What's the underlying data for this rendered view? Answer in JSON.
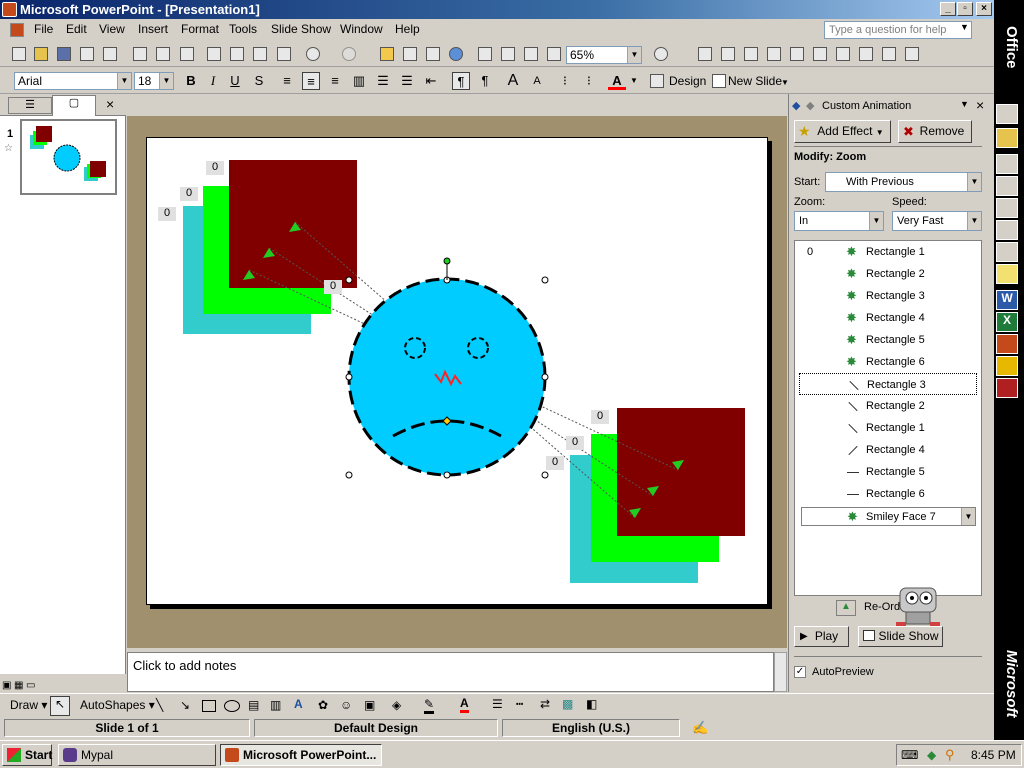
{
  "window": {
    "title": "Microsoft PowerPoint - [Presentation1]"
  },
  "menu": [
    "File",
    "Edit",
    "View",
    "Insert",
    "Format",
    "Tools",
    "Slide Show",
    "Window",
    "Help"
  ],
  "help_placeholder": "Type a question for help",
  "toolbar": {
    "zoom": "65%",
    "font": "Arial",
    "size": "18",
    "design": "Design",
    "new_slide": "New Slide"
  },
  "slide_panel": {
    "number": "1"
  },
  "slide": {
    "tag_values": [
      "0",
      "0",
      "0",
      "0",
      "0",
      "0",
      "0"
    ],
    "colors": {
      "teal": "#33cccc",
      "green": "#00ff00",
      "maroon": "#800000",
      "face": "#00ccff"
    }
  },
  "notes": {
    "placeholder": "Click to add notes"
  },
  "task_pane": {
    "title": "Custom Animation",
    "add_effect": "Add Effect",
    "remove": "Remove",
    "modify": "Modify: Zoom",
    "start_label": "Start:",
    "start_value": "With Previous",
    "zoom_label": "Zoom:",
    "zoom_value": "In",
    "speed_label": "Speed:",
    "speed_value": "Very Fast",
    "list_first_index": "0",
    "items": [
      "Rectangle 1",
      "Rectangle 2",
      "Rectangle 3",
      "Rectangle 4",
      "Rectangle 5",
      "Rectangle 6",
      "Rectangle 3",
      "Rectangle 2",
      "Rectangle 1",
      "Rectangle 4",
      "Rectangle 5",
      "Rectangle 6",
      "Smiley Face 7"
    ],
    "reorder": "Re-Order",
    "play": "Play",
    "slide_show": "Slide Show",
    "autopreview": "AutoPreview"
  },
  "drawbar": {
    "draw": "Draw",
    "autoshapes": "AutoShapes"
  },
  "status": {
    "slide": "Slide 1 of 1",
    "design": "Default Design",
    "language": "English (U.S.)"
  },
  "taskbar": {
    "start": "Start",
    "app1": "Mypal",
    "app2": "Microsoft PowerPoint...",
    "clock": "8:45 PM"
  },
  "office_bar": {
    "top": "Office",
    "bottom": "Microsoft"
  }
}
